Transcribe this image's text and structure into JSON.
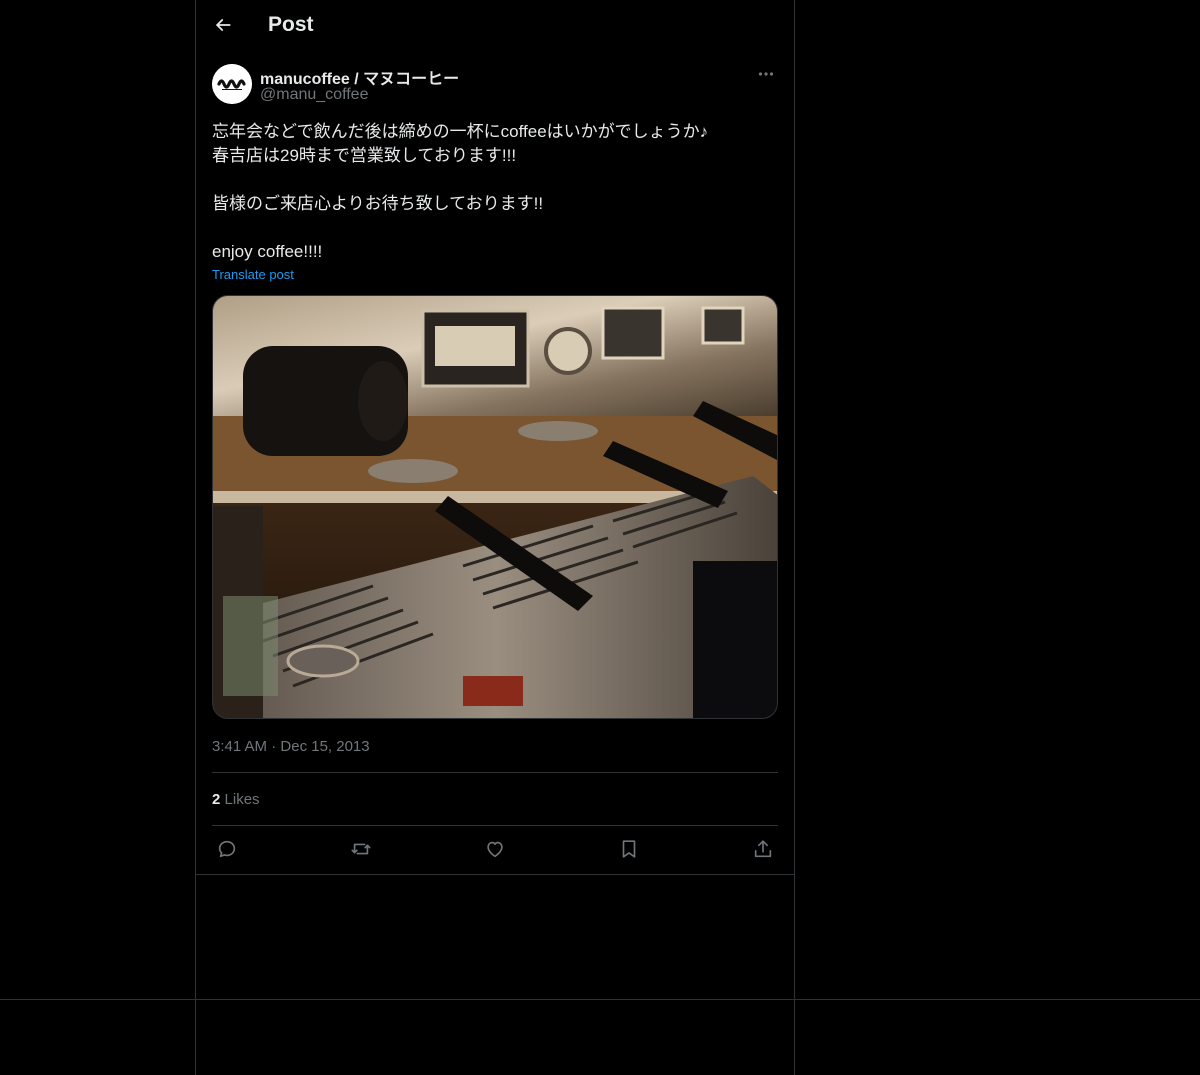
{
  "header": {
    "title": "Post"
  },
  "author": {
    "display_name": "manucoffee / マヌコーヒー",
    "handle": "@manu_coffee"
  },
  "tweet": {
    "lines": [
      "忘年会などで飲んだ後は締めの一杯にcoffeeはいかがでしょうか♪",
      "春吉店は29時まで営業致しております!!!",
      "",
      "皆様のご来店心よりお待ち致しております!!",
      "",
      "enjoy coffee!!!!"
    ],
    "translate_label": "Translate post",
    "time": "3:41 AM",
    "date_separator": "·",
    "date": "Dec 15, 2013"
  },
  "stats": {
    "likes_count": "2",
    "likes_label": "Likes"
  },
  "actions": {
    "reply_icon": "reply-icon",
    "repost_icon": "repost-icon",
    "like_icon": "like-icon",
    "bookmark_icon": "bookmark-icon",
    "share_icon": "share-icon"
  },
  "colors": {
    "background": "#000000",
    "text": "#e7e9ea",
    "secondary": "#71767b",
    "link": "#1d9bf0",
    "border": "#2f3336"
  }
}
